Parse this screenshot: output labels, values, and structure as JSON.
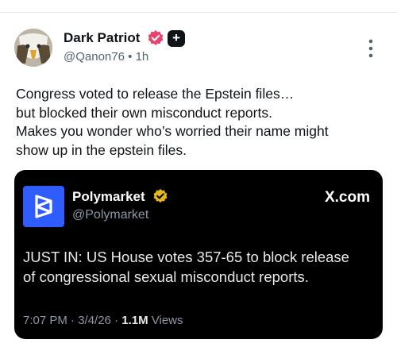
{
  "post": {
    "author_name": "Dark Patriot",
    "handle": "@Qanon76",
    "separator": "•",
    "time": "1h",
    "lines": [
      "Congress voted to release the Epstein files…",
      "but blocked their own misconduct reports.",
      "Makes you wonder who’s worried their name might",
      "show up in the epstein files."
    ],
    "plus_badge": "+"
  },
  "embed": {
    "account_name": "Polymarket",
    "handle": "@Polymarket",
    "source": "X.com",
    "lines": [
      "JUST IN: US House votes 357-65 to block release",
      "of congressional sexual misconduct reports."
    ],
    "timestamp": "7:07 PM · 3/4/26 · ",
    "views_count": "1.1M",
    "views_label": " Views"
  },
  "colors": {
    "verified_pink": "#e8426e",
    "polymarket_blue": "#2e5cff",
    "gold_badge": "#e2b719",
    "card_bg": "#000000"
  },
  "icons": [
    "eagle-avatar",
    "verified-badge-icon",
    "plus-badge-icon",
    "more-vertical-icon",
    "polymarket-logo",
    "gold-verified-icon"
  ]
}
